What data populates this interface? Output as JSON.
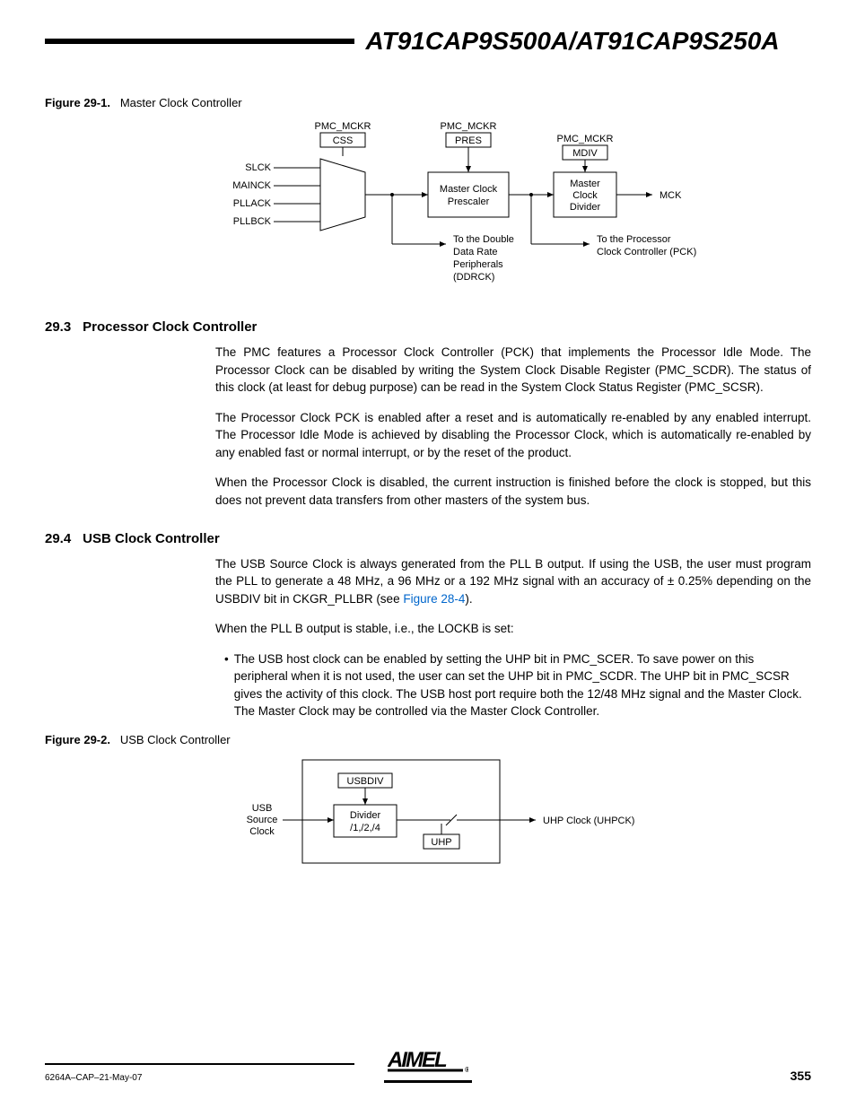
{
  "doc_title": "AT91CAP9S500A/AT91CAP9S250A",
  "figure1": {
    "label_bold": "Figure 29-1.",
    "label_text": "Master Clock Controller",
    "reg1_top": "PMC_MCKR",
    "reg1_field": "CSS",
    "reg2_top": "PMC_MCKR",
    "reg2_field": "PRES",
    "reg3_top": "PMC_MCKR",
    "reg3_field": "MDIV",
    "in1": "SLCK",
    "in2": "MAINCK",
    "in3": "PLLACK",
    "in4": "PLLBCK",
    "box_prescaler_l1": "Master Clock",
    "box_prescaler_l2": "Prescaler",
    "box_divider_l1": "Master",
    "box_divider_l2": "Clock",
    "box_divider_l3": "Divider",
    "out_mck": "MCK",
    "note_ddr_l1": "To the Double",
    "note_ddr_l2": "Data Rate",
    "note_ddr_l3": "Peripherals",
    "note_ddr_l4": "(DDRCK)",
    "note_pck_l1": "To the Processor",
    "note_pck_l2": "Clock Controller (PCK)"
  },
  "section293": {
    "num": "29.3",
    "title": "Processor Clock Controller",
    "p1": "The PMC features a Processor Clock Controller (PCK) that implements the Processor Idle Mode. The Processor Clock can be disabled by writing the System Clock Disable Register (PMC_SCDR). The status of this clock (at least for debug purpose) can be read in the System Clock Status Register (PMC_SCSR).",
    "p2": "The Processor Clock PCK is enabled after a reset and is automatically re-enabled by any enabled interrupt. The Processor Idle Mode is achieved by disabling the Processor Clock, which is automatically re-enabled by any enabled fast or normal interrupt, or by the reset of the product.",
    "p3": "When the Processor Clock is disabled, the current instruction is finished before the clock is stopped, but this does not prevent data transfers from other masters of the system bus."
  },
  "section294": {
    "num": "29.4",
    "title": "USB Clock Controller",
    "p1a": "The USB Source Clock is always generated from the PLL B output. If using the USB, the user must program the PLL to generate a 48 MHz, a 96 MHz or a 192 MHz signal with an accuracy of ± 0.25% depending on the USBDIV bit in CKGR_PLLBR (see ",
    "p1_link": "Figure 28-4",
    "p1b": ").",
    "p2": "When the PLL B output is stable, i.e., the LOCKB is set:",
    "bullet1": "The USB host clock can be enabled by setting the UHP bit in PMC_SCER. To save power on this peripheral when it is not used, the user can set the UHP bit in PMC_SCDR. The UHP bit in PMC_SCSR gives the activity of this clock. The USB host port require both the 12/48 MHz signal and the Master Clock. The Master Clock may be controlled via the Master Clock Controller."
  },
  "figure2": {
    "label_bold": "Figure 29-2.",
    "label_text": "USB Clock Controller",
    "reg_top": "USBDIV",
    "in_l1": "USB",
    "in_l2": "Source",
    "in_l3": "Clock",
    "box_div_l1": "Divider",
    "box_div_l2": "/1,/2,/4",
    "reg_uhp": "UHP",
    "out": "UHP Clock (UHPCK)"
  },
  "footer": {
    "docnum": "6264A–CAP–21-May-07",
    "logo": "ATMEL",
    "page": "355"
  }
}
